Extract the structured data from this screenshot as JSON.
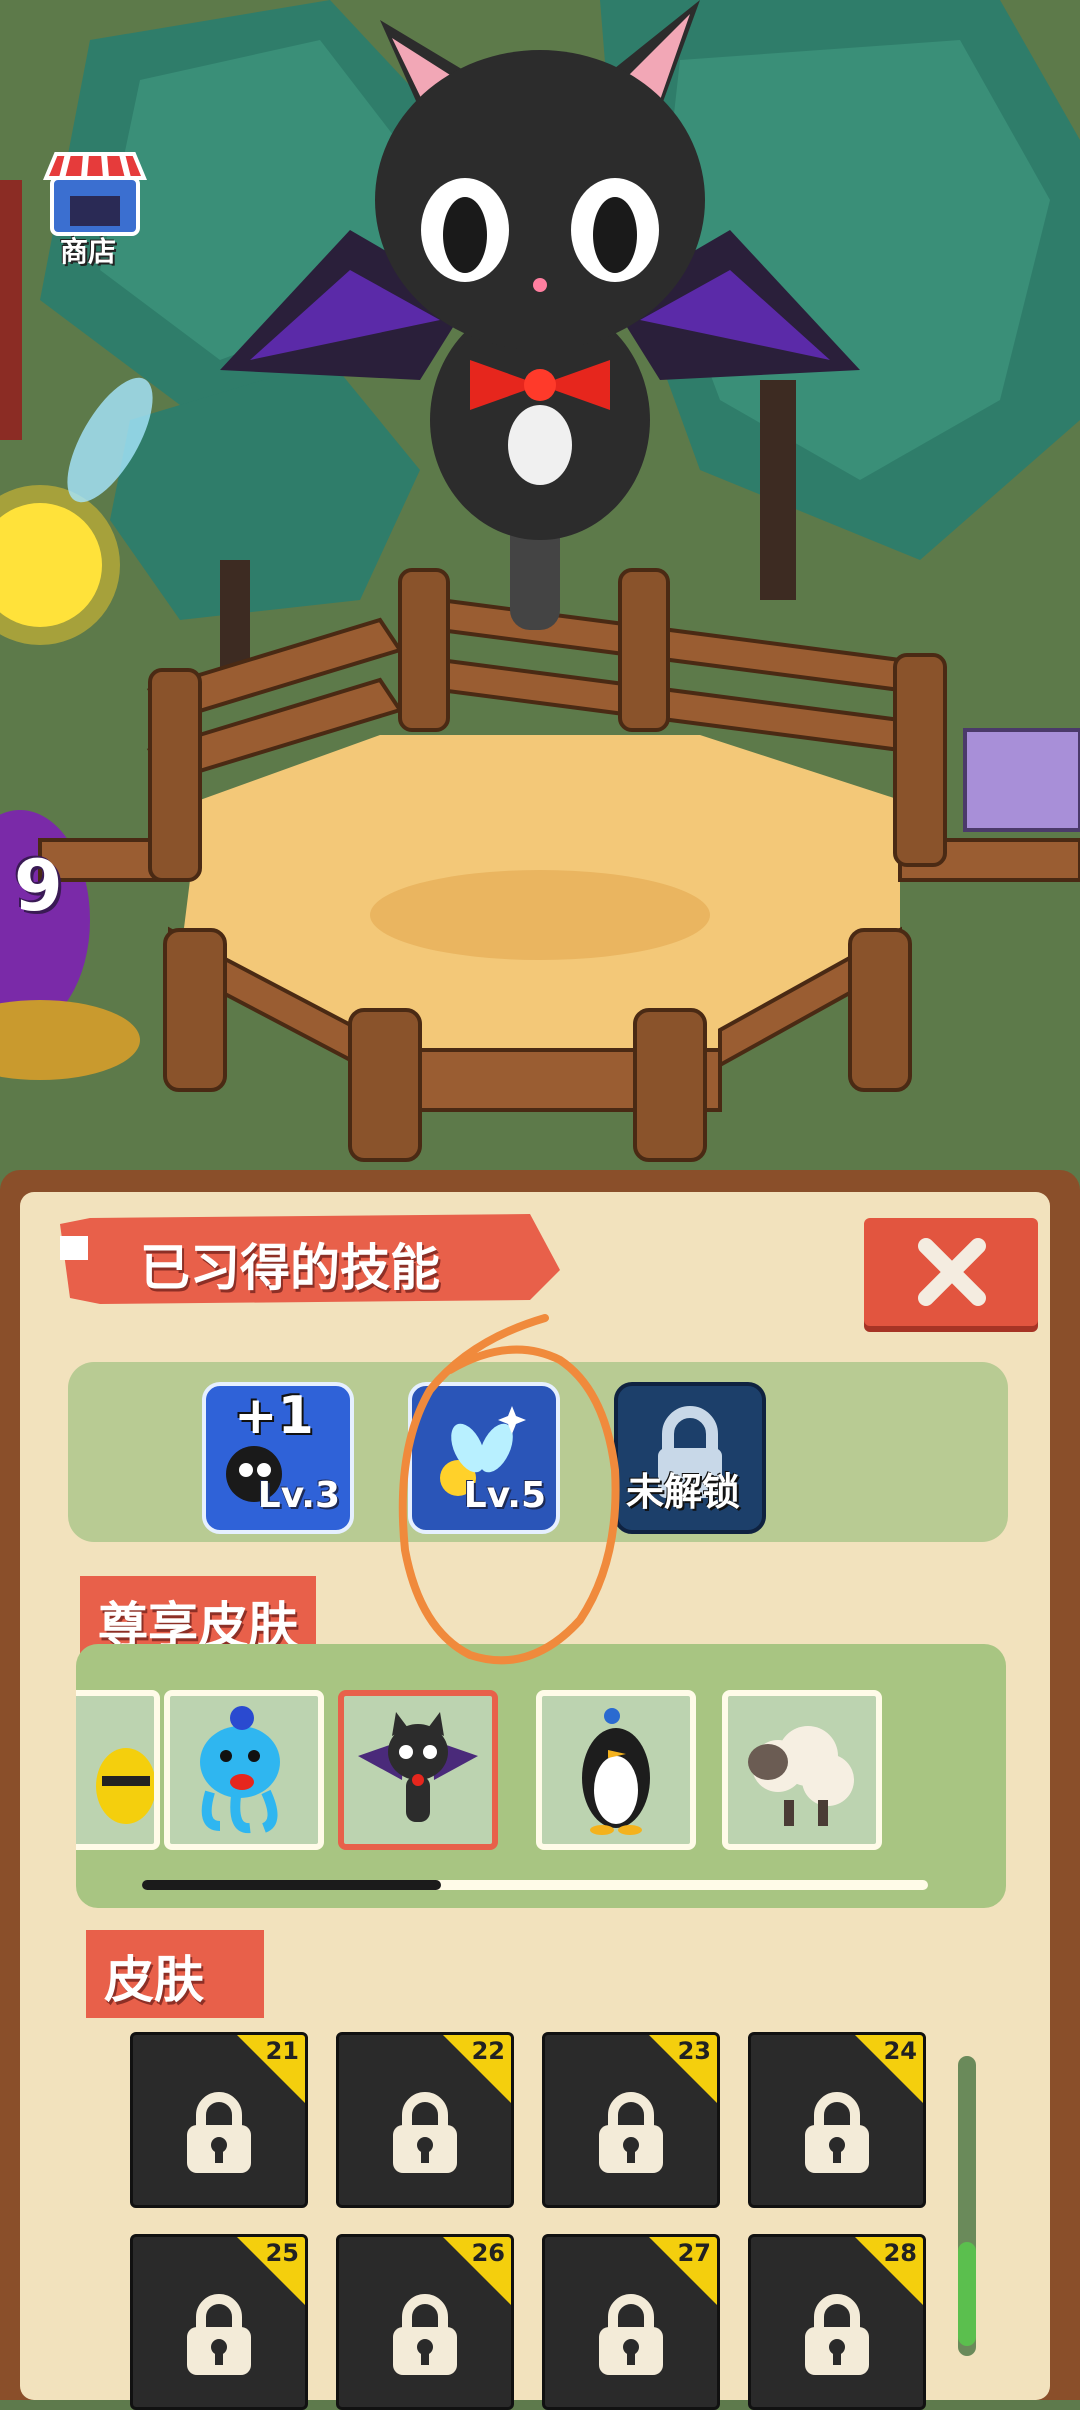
{
  "shop": {
    "label": "商店",
    "icon": "shop-icon"
  },
  "scene": {
    "side_number": "9"
  },
  "panel": {
    "title": "已习得的技能",
    "close_icon": "close-icon",
    "skills": [
      {
        "icon": "plus-one-bomb-icon",
        "badge": "+1",
        "level": "Lv.3"
      },
      {
        "icon": "fairy-icon",
        "level": "Lv.5"
      },
      {
        "icon": "lock-icon",
        "level": "未解锁"
      }
    ],
    "premium_section": {
      "label": "尊享皮肤",
      "selected_index": 2,
      "scroll_fraction": 0.27
    },
    "skins_section": {
      "label": "皮肤",
      "items": [
        {
          "number": "21"
        },
        {
          "number": "22"
        },
        {
          "number": "23"
        },
        {
          "number": "24"
        },
        {
          "number": "25"
        },
        {
          "number": "26"
        },
        {
          "number": "27"
        },
        {
          "number": "28"
        }
      ]
    }
  },
  "colors": {
    "accent": "#e8604a",
    "panel": "#f2e2bd",
    "frame": "#8a4f2a",
    "badge": "#f4cf0d"
  }
}
